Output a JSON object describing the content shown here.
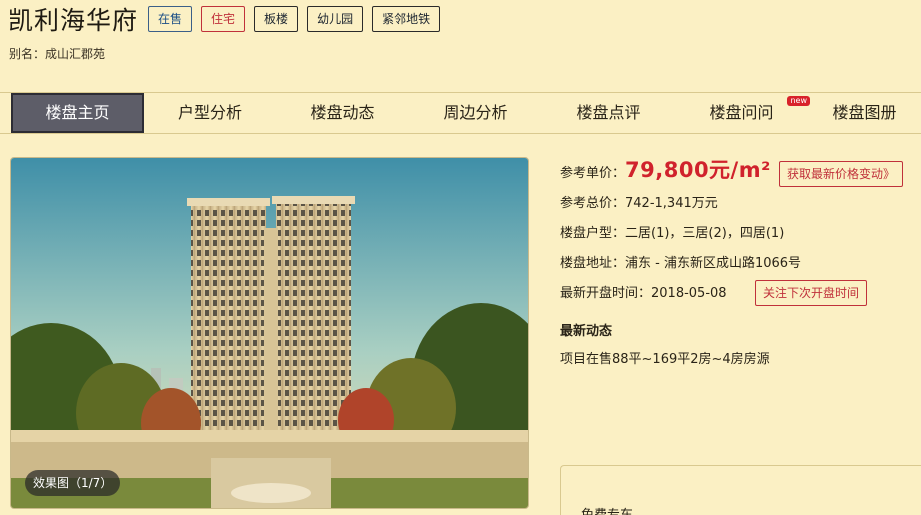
{
  "header": {
    "title": "凯利海华府",
    "tags": [
      "在售",
      "住宅",
      "板楼",
      "幼儿园",
      "紧邻地铁"
    ],
    "alias": "别名：成山汇郡苑"
  },
  "nav": {
    "tabs": [
      "楼盘主页",
      "户型分析",
      "楼盘动态",
      "周边分析",
      "楼盘点评",
      "楼盘问问",
      "楼盘图册"
    ],
    "new_badge": "new"
  },
  "gallery": {
    "caption": "效果图（1/7）"
  },
  "info": {
    "price_label": "参考单价：",
    "price_value": "79,800元/m²",
    "price_button": "获取最新价格变动》",
    "total_label": "参考总价：",
    "total_value": "742-1,341万元",
    "layout_label": "楼盘户型：",
    "layout_value": "二居(1)，三居(2)，四居(1)",
    "address_label": "楼盘地址：",
    "address_value": "浦东 - 浦东新区成山路1066号",
    "open_label": "最新开盘时间：",
    "open_value": "2018-05-08",
    "open_button": "关注下次开盘时间",
    "news_title": "最新动态",
    "news_text": "项目在售88平~169平2房~4房房源"
  },
  "panel2": {
    "title": "免费专车"
  },
  "colors": {
    "background": "#fbf0c4",
    "accent_red": "#d0222c",
    "active_tab": "#5d5d68"
  }
}
